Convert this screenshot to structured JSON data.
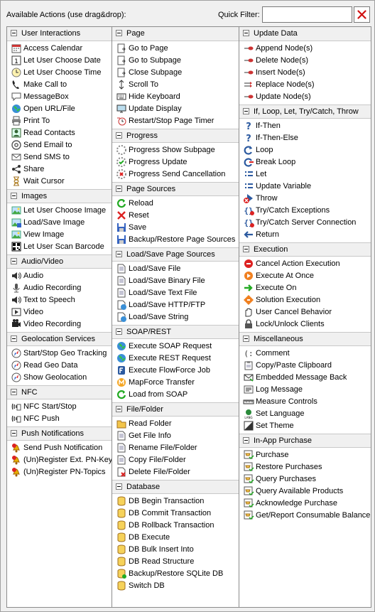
{
  "header": {
    "title": "Available Actions (use drag&drop):",
    "quick_filter_label": "Quick Filter:",
    "quick_filter_value": "",
    "clear_icon": "clear-x-icon"
  },
  "columns": [
    {
      "sections": [
        {
          "title": "User Interactions",
          "items": [
            {
              "label": "Access Calendar",
              "icon": "calendar"
            },
            {
              "label": "Let User Choose Date",
              "icon": "date"
            },
            {
              "label": "Let User Choose Time",
              "icon": "clock"
            },
            {
              "label": "Make Call to",
              "icon": "phone"
            },
            {
              "label": "MessageBox",
              "icon": "chat"
            },
            {
              "label": "Open URL/File",
              "icon": "globe"
            },
            {
              "label": "Print To",
              "icon": "print"
            },
            {
              "label": "Read Contacts",
              "icon": "contacts"
            },
            {
              "label": "Send Email to",
              "icon": "at"
            },
            {
              "label": "Send SMS to",
              "icon": "mail"
            },
            {
              "label": "Share",
              "icon": "share"
            },
            {
              "label": "Wait Cursor",
              "icon": "hourglass"
            }
          ]
        },
        {
          "title": "Images",
          "items": [
            {
              "label": "Let User Choose Image",
              "icon": "image"
            },
            {
              "label": "Load/Save Image",
              "icon": "image-save"
            },
            {
              "label": "View Image",
              "icon": "image"
            },
            {
              "label": "Let User Scan Barcode",
              "icon": "qr"
            }
          ]
        },
        {
          "title": "Audio/Video",
          "items": [
            {
              "label": "Audio",
              "icon": "speaker"
            },
            {
              "label": "Audio Recording",
              "icon": "mic"
            },
            {
              "label": "Text to Speech",
              "icon": "speaker"
            },
            {
              "label": "Video",
              "icon": "video"
            },
            {
              "label": "Video Recording",
              "icon": "camera"
            }
          ]
        },
        {
          "title": "Geolocation Services",
          "items": [
            {
              "label": "Start/Stop Geo Tracking",
              "icon": "compass"
            },
            {
              "label": "Read Geo Data",
              "icon": "compass"
            },
            {
              "label": "Show Geolocation",
              "icon": "compass"
            }
          ]
        },
        {
          "title": "NFC",
          "items": [
            {
              "label": "NFC Start/Stop",
              "icon": "nfc"
            },
            {
              "label": "NFC Push",
              "icon": "nfc"
            }
          ]
        },
        {
          "title": "Push Notifications",
          "items": [
            {
              "label": "Send Push Notification",
              "icon": "bell"
            },
            {
              "label": "(Un)Register Ext. PN-Key",
              "icon": "bell"
            },
            {
              "label": "(Un)Register PN-Topics",
              "icon": "bell"
            }
          ]
        }
      ]
    },
    {
      "sections": [
        {
          "title": "Page",
          "items": [
            {
              "label": "Go to Page",
              "icon": "page"
            },
            {
              "label": "Go to Subpage",
              "icon": "page"
            },
            {
              "label": "Close Subpage",
              "icon": "page"
            },
            {
              "label": "Scroll To",
              "icon": "scroll"
            },
            {
              "label": "Hide Keyboard",
              "icon": "keyboard"
            },
            {
              "label": "Update Display",
              "icon": "display"
            },
            {
              "label": "Restart/Stop Page Timer",
              "icon": "timer"
            }
          ]
        },
        {
          "title": "Progress",
          "items": [
            {
              "label": "Progress Show Subpage",
              "icon": "progress"
            },
            {
              "label": "Progress Update",
              "icon": "progress-green"
            },
            {
              "label": "Progress Send Cancellation",
              "icon": "progress-red"
            }
          ]
        },
        {
          "title": "Page Sources",
          "items": [
            {
              "label": "Reload",
              "icon": "reload"
            },
            {
              "label": "Reset",
              "icon": "redx"
            },
            {
              "label": "Save",
              "icon": "disk"
            },
            {
              "label": "Backup/Restore Page Sources",
              "icon": "disk"
            }
          ]
        },
        {
          "title": "Load/Save Page Sources",
          "items": [
            {
              "label": "Load/Save File",
              "icon": "file"
            },
            {
              "label": "Load/Save Binary File",
              "icon": "file"
            },
            {
              "label": "Load/Save Text File",
              "icon": "file"
            },
            {
              "label": "Load/Save HTTP/FTP",
              "icon": "file-globe"
            },
            {
              "label": "Load/Save String",
              "icon": "file-globe"
            }
          ]
        },
        {
          "title": "SOAP/REST",
          "items": [
            {
              "label": "Execute SOAP Request",
              "icon": "globe"
            },
            {
              "label": "Execute REST Request",
              "icon": "globe"
            },
            {
              "label": "Execute FlowForce Job",
              "icon": "flowforce"
            },
            {
              "label": "MapForce Transfer",
              "icon": "mapforce"
            },
            {
              "label": "Load from SOAP",
              "icon": "reload"
            }
          ]
        },
        {
          "title": "File/Folder",
          "items": [
            {
              "label": "Read Folder",
              "icon": "folder"
            },
            {
              "label": "Get File Info",
              "icon": "file"
            },
            {
              "label": "Rename File/Folder",
              "icon": "file"
            },
            {
              "label": "Copy File/Folder",
              "icon": "file"
            },
            {
              "label": "Delete File/Folder",
              "icon": "file-del"
            }
          ]
        },
        {
          "title": "Database",
          "items": [
            {
              "label": "DB Begin Transaction",
              "icon": "db"
            },
            {
              "label": "DB Commit Transaction",
              "icon": "db"
            },
            {
              "label": "DB Rollback Transaction",
              "icon": "db"
            },
            {
              "label": "DB Execute",
              "icon": "db"
            },
            {
              "label": "DB Bulk Insert Into",
              "icon": "db"
            },
            {
              "label": "DB Read Structure",
              "icon": "db"
            },
            {
              "label": "Backup/Restore SQLite DB",
              "icon": "db-green"
            },
            {
              "label": "Switch DB",
              "icon": "db"
            }
          ]
        }
      ]
    },
    {
      "sections": [
        {
          "title": "Update Data",
          "items": [
            {
              "label": "Append Node(s)",
              "icon": "node"
            },
            {
              "label": "Delete Node(s)",
              "icon": "node"
            },
            {
              "label": "Insert Node(s)",
              "icon": "node"
            },
            {
              "label": "Replace Node(s)",
              "icon": "replace"
            },
            {
              "label": "Update Node(s)",
              "icon": "node"
            }
          ]
        },
        {
          "title": "If, Loop, Let, Try/Catch, Throw",
          "items": [
            {
              "label": "If-Then",
              "icon": "question"
            },
            {
              "label": "If-Then-Else",
              "icon": "question"
            },
            {
              "label": "Loop",
              "icon": "loop"
            },
            {
              "label": "Break Loop",
              "icon": "break"
            },
            {
              "label": "Let",
              "icon": "let"
            },
            {
              "label": "Update Variable",
              "icon": "let"
            },
            {
              "label": "Throw",
              "icon": "throw"
            },
            {
              "label": "Try/Catch Exceptions",
              "icon": "braces"
            },
            {
              "label": "Try/Catch Server Connection",
              "icon": "braces"
            },
            {
              "label": "Return",
              "icon": "return"
            }
          ]
        },
        {
          "title": "Execution",
          "items": [
            {
              "label": "Cancel Action Execution",
              "icon": "cancel"
            },
            {
              "label": "Execute At Once",
              "icon": "exec"
            },
            {
              "label": "Execute On",
              "icon": "exec-on"
            },
            {
              "label": "Solution Execution",
              "icon": "solution"
            },
            {
              "label": "User Cancel Behavior",
              "icon": "hand"
            },
            {
              "label": "Lock/Unlock Clients",
              "icon": "lock"
            }
          ]
        },
        {
          "title": "Miscellaneous",
          "items": [
            {
              "label": "Comment",
              "icon": "comment"
            },
            {
              "label": "Copy/Paste Clipboard",
              "icon": "clipboard"
            },
            {
              "label": "Embedded Message Back",
              "icon": "envelope"
            },
            {
              "label": "Log Message",
              "icon": "log"
            },
            {
              "label": "Measure Controls",
              "icon": "ruler"
            },
            {
              "label": "Set Language",
              "icon": "lang"
            },
            {
              "label": "Set Theme",
              "icon": "theme"
            }
          ]
        },
        {
          "title": "In-App Purchase",
          "items": [
            {
              "label": "Purchase",
              "icon": "cart"
            },
            {
              "label": "Restore Purchases",
              "icon": "cart"
            },
            {
              "label": "Query Purchases",
              "icon": "cart"
            },
            {
              "label": "Query Available Products",
              "icon": "cart"
            },
            {
              "label": "Acknowledge Purchase",
              "icon": "cart"
            },
            {
              "label": "Get/Report Consumable Balance",
              "icon": "cart"
            }
          ]
        }
      ]
    }
  ]
}
